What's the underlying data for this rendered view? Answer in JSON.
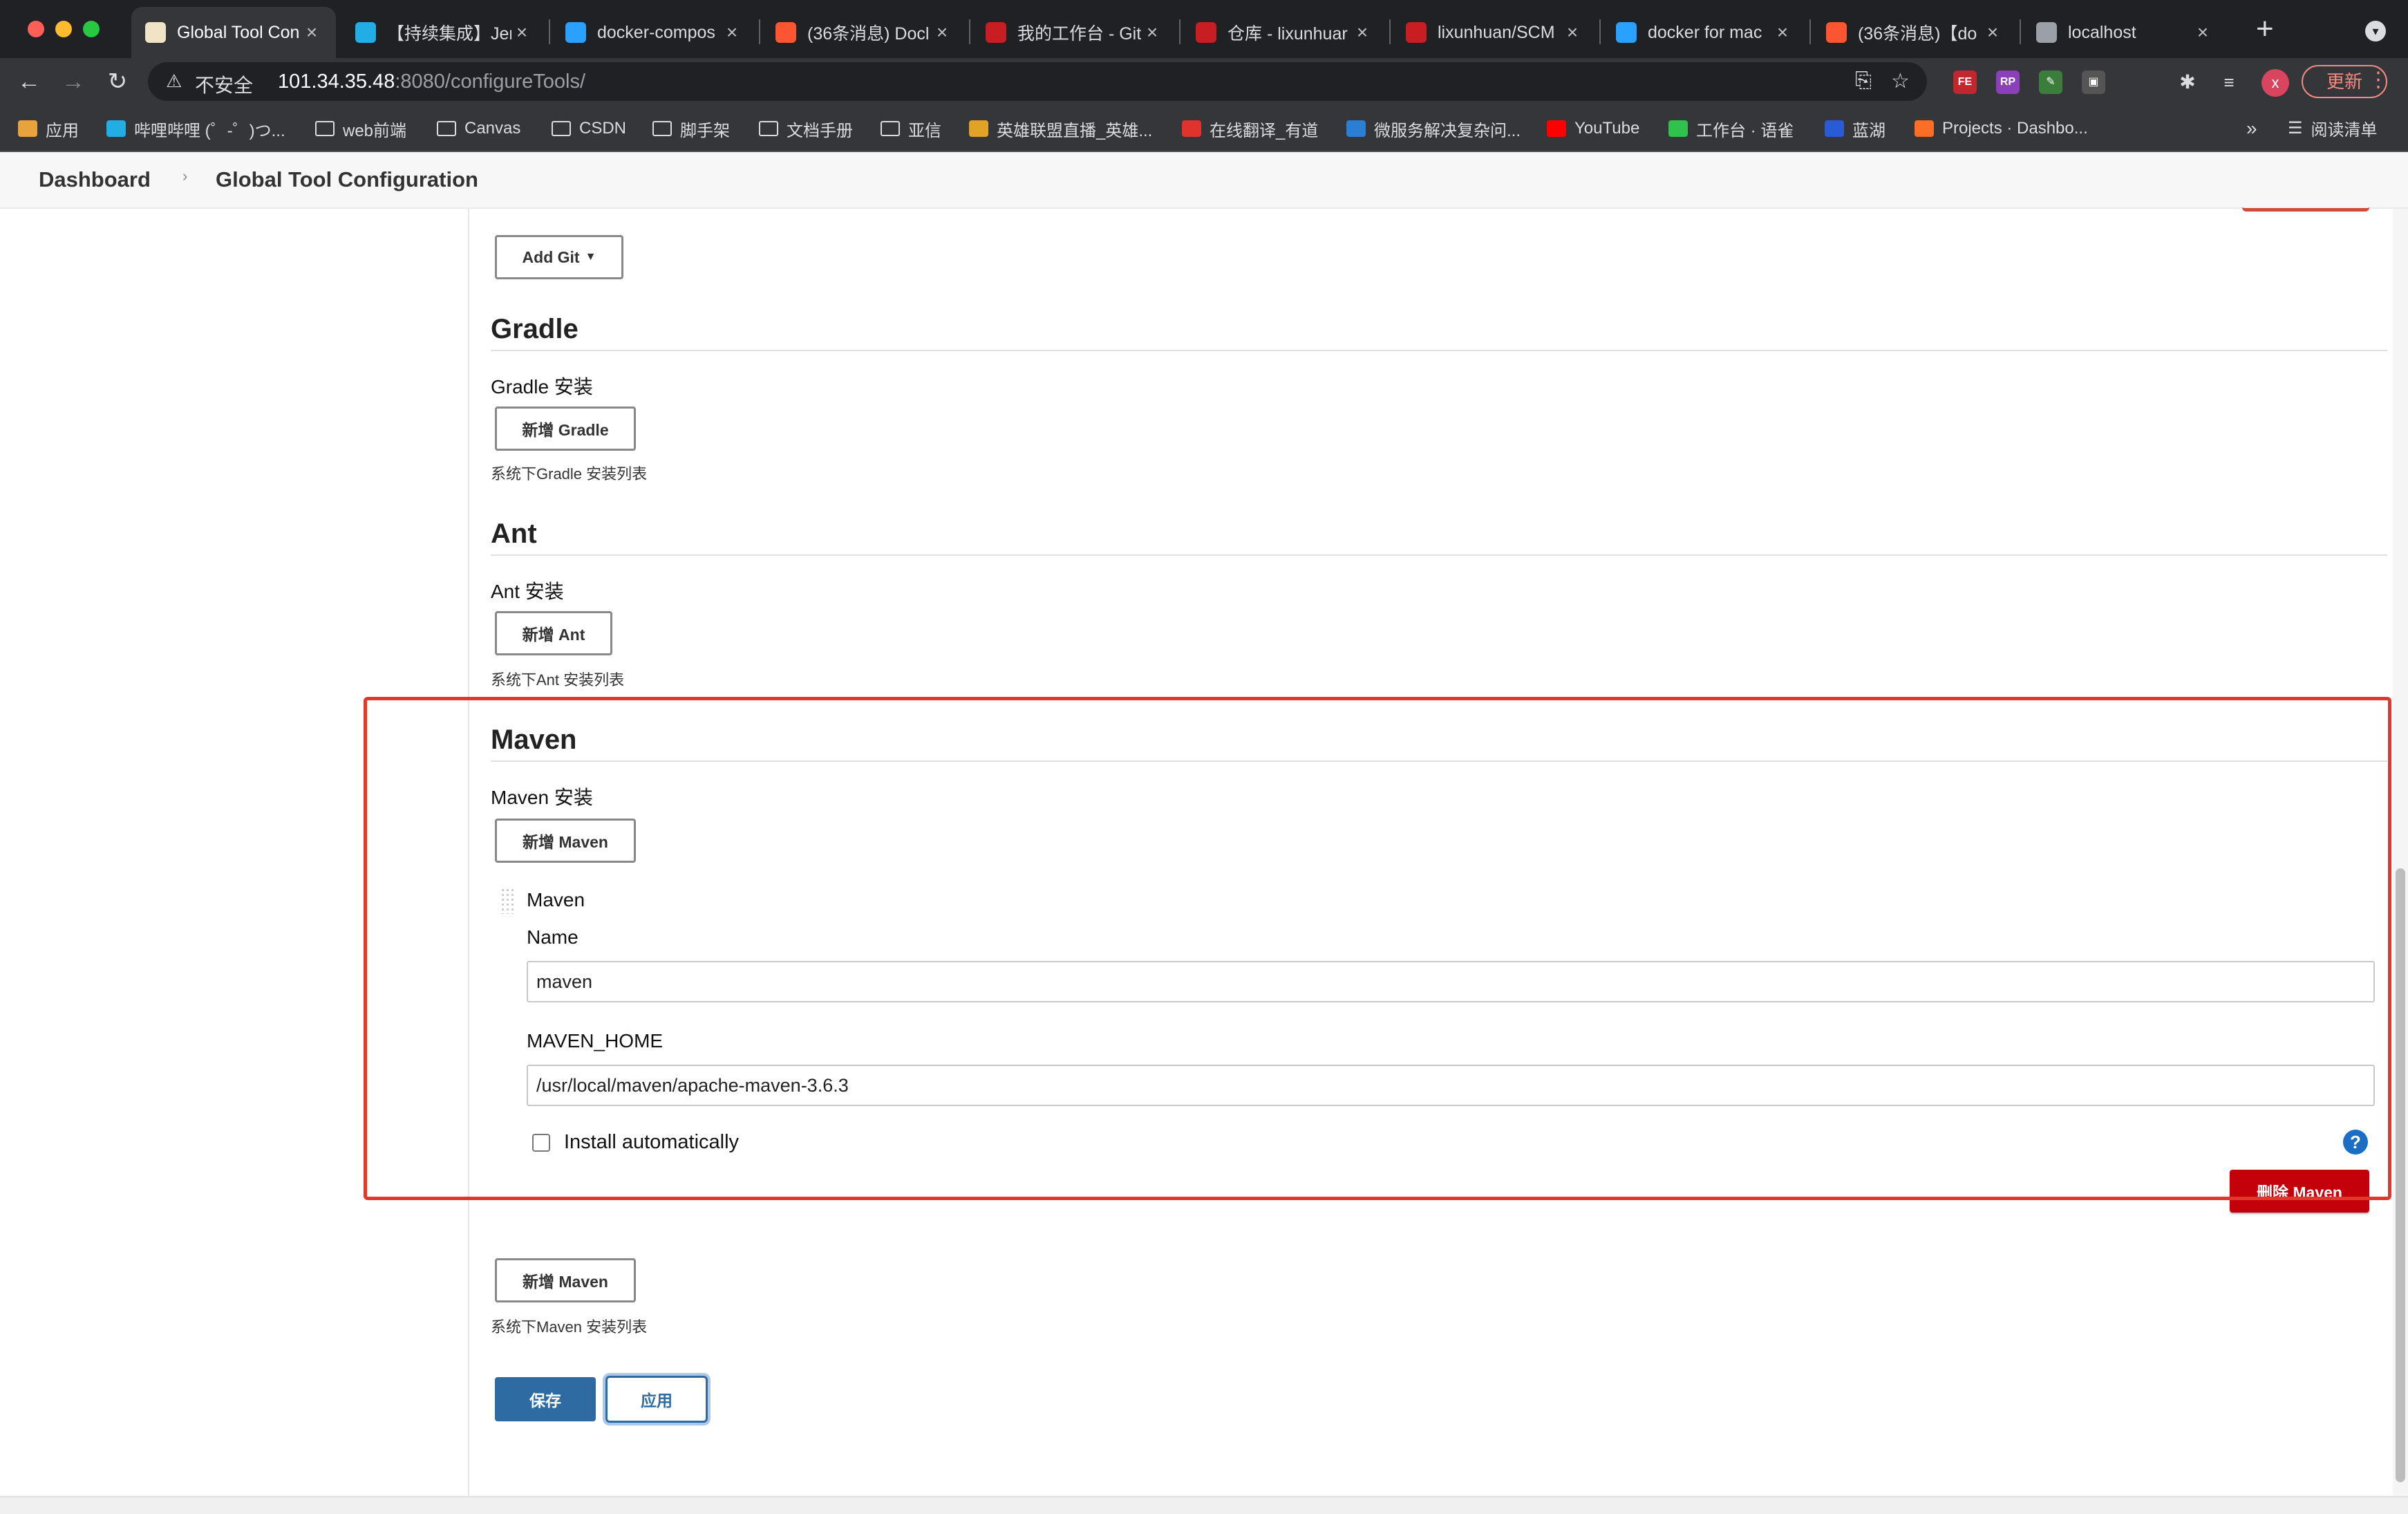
{
  "browser": {
    "tabs": [
      {
        "title": "Global Tool Con",
        "favicon": "jenkins-icon",
        "color": "#ffffff",
        "active": true
      },
      {
        "title": "【持续集成】Jen",
        "favicon": "bilibili-icon",
        "color": "#23ade5"
      },
      {
        "title": "docker-compos",
        "favicon": "bing-icon",
        "color": "#2aa1ff"
      },
      {
        "title": "(36条消息) Docl",
        "favicon": "csdn-icon",
        "color": "#fc5531"
      },
      {
        "title": "我的工作台 - Git",
        "favicon": "gitee-icon",
        "color": "#c71d23"
      },
      {
        "title": "仓库 - lixunhuar",
        "favicon": "gitee-icon",
        "color": "#c71d23"
      },
      {
        "title": "lixunhuan/SCM",
        "favicon": "gitee-icon",
        "color": "#c71d23"
      },
      {
        "title": "docker for mac",
        "favicon": "bing-icon",
        "color": "#2aa1ff"
      },
      {
        "title": "(36条消息)【do",
        "favicon": "csdn-icon",
        "color": "#fc5531"
      },
      {
        "title": "localhost",
        "favicon": "globe-icon",
        "color": "#9aa0a6"
      }
    ],
    "address": {
      "security_label": "不安全",
      "host": "101.34.35.48",
      "path": ":8080/configureTools/"
    },
    "update_label": "更新",
    "avatar_letter": "x",
    "extensions": [
      {
        "label": "FE",
        "color": "#c1272d"
      },
      {
        "label": "RP",
        "color": "#8b3fb8"
      },
      {
        "label": "✎",
        "color": "#3b7d3b"
      },
      {
        "label": "▣",
        "color": "#555555"
      }
    ],
    "bookmarks": [
      {
        "label": "应用",
        "icon": "apps-grid-icon"
      },
      {
        "label": "哔哩哔哩 (゜-゜)つ...",
        "icon": "bilibili-icon"
      },
      {
        "label": "web前端",
        "icon": "folder-icon"
      },
      {
        "label": "Canvas",
        "icon": "folder-icon"
      },
      {
        "label": "CSDN",
        "icon": "folder-icon"
      },
      {
        "label": "脚手架",
        "icon": "folder-icon"
      },
      {
        "label": "文档手册",
        "icon": "folder-icon"
      },
      {
        "label": "亚信",
        "icon": "folder-icon"
      },
      {
        "label": "英雄联盟直播_英雄...",
        "icon": "lol-icon"
      },
      {
        "label": "在线翻译_有道",
        "icon": "youdao-icon"
      },
      {
        "label": "微服务解决复杂问...",
        "icon": "q-icon"
      },
      {
        "label": "YouTube",
        "icon": "youtube-icon"
      },
      {
        "label": "工作台 · 语雀",
        "icon": "yuque-icon"
      },
      {
        "label": "蓝湖",
        "icon": "lanhu-icon"
      },
      {
        "label": "Projects · Dashbo...",
        "icon": "gitlab-icon"
      }
    ],
    "reading_list_label": "阅读清单"
  },
  "breadcrumb": {
    "dashboard": "Dashboard",
    "current": "Global Tool Configuration"
  },
  "git": {
    "add_label": "Add Git"
  },
  "gradle": {
    "title": "Gradle",
    "install_label": "Gradle 安装",
    "add_label": "新增 Gradle",
    "help": "系统下Gradle 安装列表"
  },
  "ant": {
    "title": "Ant",
    "install_label": "Ant 安装",
    "add_label": "新增 Ant",
    "help": "系统下Ant 安装列表"
  },
  "maven": {
    "title": "Maven",
    "install_label": "Maven 安装",
    "add_label": "新增 Maven",
    "item_header": "Maven",
    "name_label": "Name",
    "name_value": "maven",
    "home_label": "MAVEN_HOME",
    "home_value": "/usr/local/maven/apache-maven-3.6.3",
    "install_auto_label": "Install automatically",
    "install_auto_checked": false,
    "delete_label": "删除 Maven",
    "add_bottom_label": "新增 Maven",
    "help": "系统下Maven 安装列表"
  },
  "actions": {
    "save_label": "保存",
    "apply_label": "应用"
  },
  "colors": {
    "highlight": "#e2382b",
    "primary": "#2f6ba3",
    "danger": "#c4000a"
  }
}
